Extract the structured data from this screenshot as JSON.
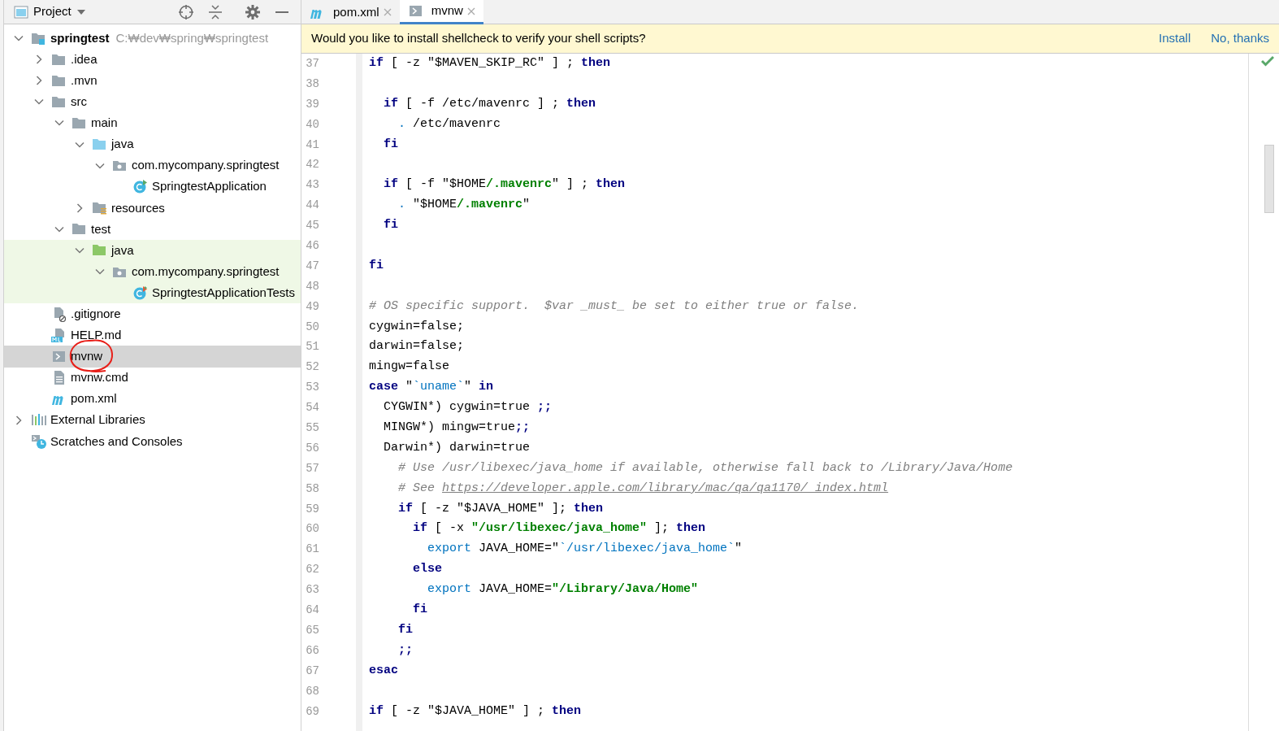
{
  "project_panel": {
    "title": "Project"
  },
  "tree": [
    {
      "label": "springtest",
      "path": "C:₩dev₩spring₩springtest",
      "kind": "project",
      "expanded": true,
      "selected": false,
      "test_scope": false,
      "children": [
        {
          "label": ".idea",
          "kind": "folder",
          "expanded": false,
          "selected": false,
          "test_scope": false
        },
        {
          "label": ".mvn",
          "kind": "folder",
          "expanded": false,
          "selected": false,
          "test_scope": false
        },
        {
          "label": "src",
          "kind": "folder",
          "expanded": true,
          "selected": false,
          "test_scope": false,
          "children": [
            {
              "label": "main",
              "kind": "folder",
              "expanded": true,
              "selected": false,
              "test_scope": false,
              "children": [
                {
                  "label": "java",
                  "kind": "source",
                  "expanded": true,
                  "selected": false,
                  "test_scope": false,
                  "children": [
                    {
                      "label": "com.mycompany.springtest",
                      "kind": "package",
                      "expanded": true,
                      "selected": false,
                      "test_scope": false,
                      "children": [
                        {
                          "label": "SpringtestApplication",
                          "kind": "class",
                          "selected": false,
                          "test_scope": false
                        }
                      ]
                    }
                  ]
                },
                {
                  "label": "resources",
                  "kind": "resources",
                  "expanded": false,
                  "selected": false,
                  "test_scope": false
                }
              ]
            },
            {
              "label": "test",
              "kind": "folder",
              "expanded": true,
              "selected": false,
              "test_scope": false,
              "children": [
                {
                  "label": "java",
                  "kind": "test-source",
                  "expanded": true,
                  "selected": false,
                  "test_scope": true,
                  "children": [
                    {
                      "label": "com.mycompany.springtest",
                      "kind": "package",
                      "expanded": true,
                      "selected": false,
                      "test_scope": true,
                      "children": [
                        {
                          "label": "SpringtestApplicationTests",
                          "kind": "test-class",
                          "selected": false,
                          "test_scope": true
                        }
                      ]
                    }
                  ]
                }
              ]
            }
          ]
        },
        {
          "label": ".gitignore",
          "kind": "ignore-file",
          "selected": false,
          "test_scope": false
        },
        {
          "label": "HELP.md",
          "kind": "markdown",
          "selected": false,
          "test_scope": false
        },
        {
          "label": "mvnw",
          "kind": "shell",
          "selected": true,
          "test_scope": false,
          "circled": true
        },
        {
          "label": "mvnw.cmd",
          "kind": "text",
          "selected": false,
          "test_scope": false
        },
        {
          "label": "pom.xml",
          "kind": "maven",
          "selected": false,
          "test_scope": false
        }
      ]
    },
    {
      "label": "External Libraries",
      "kind": "libraries",
      "expanded": false,
      "selected": false,
      "test_scope": false
    },
    {
      "label": "Scratches and Consoles",
      "kind": "scratches",
      "selected": false,
      "test_scope": false
    }
  ],
  "tabs": [
    {
      "label": "pom.xml",
      "kind": "maven",
      "selected": false
    },
    {
      "label": "mvnw",
      "kind": "shell",
      "selected": true
    }
  ],
  "notification": {
    "message": "Would you like to install shellcheck to verify your shell scripts?",
    "actions": [
      "Install",
      "No, thanks"
    ]
  },
  "editor": {
    "lines": [
      {
        "number": "37",
        "tokens": [
          {
            "kind": "kw",
            "text": "if"
          },
          {
            "kind": "plain",
            "text": " [ -z \"$MAVEN_SKIP_RC\" ] ; "
          },
          {
            "kind": "kw",
            "text": "then"
          }
        ]
      },
      {
        "number": "38"
      },
      {
        "number": "39",
        "tokens": [
          {
            "kind": "kw",
            "text": "  if"
          },
          {
            "kind": "plain",
            "text": " [ -f /etc/mavenrc ] ; "
          },
          {
            "kind": "kw",
            "text": "then"
          }
        ]
      },
      {
        "number": "40",
        "tokens": [
          {
            "kind": "builtin",
            "text": "    ."
          },
          {
            "kind": "plain",
            "text": " /etc/mavenrc"
          }
        ]
      },
      {
        "number": "41",
        "tokens": [
          {
            "kind": "kw",
            "text": "  fi"
          }
        ]
      },
      {
        "number": "42"
      },
      {
        "number": "43",
        "tokens": [
          {
            "kind": "kw",
            "text": "  if"
          },
          {
            "kind": "plain",
            "text": " [ -f \"$HOME"
          },
          {
            "kind": "str",
            "text": "/.mavenrc"
          },
          {
            "kind": "plain",
            "text": "\" ] ; "
          },
          {
            "kind": "kw",
            "text": "then"
          }
        ]
      },
      {
        "number": "44",
        "tokens": [
          {
            "kind": "builtin",
            "text": "    ."
          },
          {
            "kind": "plain",
            "text": " \"$HOME"
          },
          {
            "kind": "str",
            "text": "/.mavenrc"
          },
          {
            "kind": "plain",
            "text": "\""
          }
        ]
      },
      {
        "number": "45",
        "tokens": [
          {
            "kind": "kw",
            "text": "  fi"
          }
        ]
      },
      {
        "number": "46"
      },
      {
        "number": "47",
        "tokens": [
          {
            "kind": "kw",
            "text": "fi"
          }
        ]
      },
      {
        "number": "48"
      },
      {
        "number": "49",
        "tokens": [
          {
            "kind": "comment",
            "text": "# OS specific support.  $var _must_ be set to either true or false."
          }
        ]
      },
      {
        "number": "50",
        "tokens": [
          {
            "kind": "plain",
            "text": "cygwin=false;"
          }
        ]
      },
      {
        "number": "51",
        "tokens": [
          {
            "kind": "plain",
            "text": "darwin=false;"
          }
        ]
      },
      {
        "number": "52",
        "tokens": [
          {
            "kind": "plain",
            "text": "mingw=false"
          }
        ]
      },
      {
        "number": "53",
        "tokens": [
          {
            "kind": "kw",
            "text": "case"
          },
          {
            "kind": "plain",
            "text": " \""
          },
          {
            "kind": "builtin",
            "text": "`uname`"
          },
          {
            "kind": "plain",
            "text": "\" "
          },
          {
            "kind": "kw",
            "text": "in"
          }
        ]
      },
      {
        "number": "54",
        "tokens": [
          {
            "kind": "plain",
            "text": "  CYGWIN*) cygwin=true "
          },
          {
            "kind": "kw",
            "text": ";;"
          }
        ]
      },
      {
        "number": "55",
        "tokens": [
          {
            "kind": "plain",
            "text": "  MINGW*) mingw=true"
          },
          {
            "kind": "kw",
            "text": ";;"
          }
        ]
      },
      {
        "number": "56",
        "tokens": [
          {
            "kind": "plain",
            "text": "  Darwin*) darwin=true"
          }
        ]
      },
      {
        "number": "57",
        "tokens": [
          {
            "kind": "comment",
            "text": "    # Use /usr/libexec/java_home if available, otherwise fall back to /Library/Java/Home"
          }
        ]
      },
      {
        "number": "58",
        "tokens": [
          {
            "kind": "comment",
            "text": "    # See "
          },
          {
            "kind": "link",
            "text": "https://developer.apple.com/library/mac/qa/qa1170/_index.html"
          }
        ]
      },
      {
        "number": "59",
        "tokens": [
          {
            "kind": "kw",
            "text": "    if"
          },
          {
            "kind": "plain",
            "text": " [ -z \"$JAVA_HOME\" ]; "
          },
          {
            "kind": "kw",
            "text": "then"
          }
        ]
      },
      {
        "number": "60",
        "tokens": [
          {
            "kind": "kw",
            "text": "      if"
          },
          {
            "kind": "plain",
            "text": " [ -x "
          },
          {
            "kind": "str",
            "text": "\"/usr/libexec/java_home\""
          },
          {
            "kind": "plain",
            "text": " ]; "
          },
          {
            "kind": "kw",
            "text": "then"
          }
        ]
      },
      {
        "number": "61",
        "tokens": [
          {
            "kind": "builtin",
            "text": "        export"
          },
          {
            "kind": "plain",
            "text": " JAVA_HOME=\""
          },
          {
            "kind": "builtin",
            "text": "`/usr/libexec/java_home`"
          },
          {
            "kind": "plain",
            "text": "\""
          }
        ]
      },
      {
        "number": "62",
        "tokens": [
          {
            "kind": "kw",
            "text": "      else"
          }
        ]
      },
      {
        "number": "63",
        "tokens": [
          {
            "kind": "builtin",
            "text": "        export"
          },
          {
            "kind": "plain",
            "text": " JAVA_HOME="
          },
          {
            "kind": "str",
            "text": "\"/Library/Java/Home\""
          }
        ]
      },
      {
        "number": "64",
        "tokens": [
          {
            "kind": "kw",
            "text": "      fi"
          }
        ]
      },
      {
        "number": "65",
        "tokens": [
          {
            "kind": "kw",
            "text": "    fi"
          }
        ]
      },
      {
        "number": "66",
        "tokens": [
          {
            "kind": "kw",
            "text": "    ;;"
          }
        ]
      },
      {
        "number": "67",
        "tokens": [
          {
            "kind": "kw",
            "text": "esac"
          }
        ]
      },
      {
        "number": "68"
      },
      {
        "number": "69",
        "tokens": [
          {
            "kind": "kw",
            "text": "if"
          },
          {
            "kind": "plain",
            "text": " [ -z \"$JAVA_HOME\" ] ; "
          },
          {
            "kind": "kw",
            "text": "then"
          }
        ]
      }
    ]
  }
}
